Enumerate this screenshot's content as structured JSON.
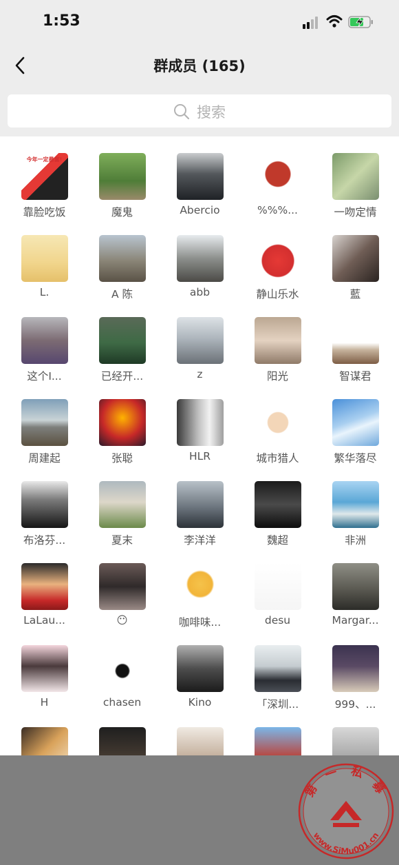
{
  "status_bar": {
    "time": "1:53",
    "icons": [
      "signal-icon",
      "wifi-icon",
      "battery-charging-icon"
    ]
  },
  "nav": {
    "back_icon": "chevron-left-icon",
    "title": "群成员 (165)"
  },
  "search": {
    "icon": "search-icon",
    "placeholder": "搜索"
  },
  "members": [
    {
      "name": "靠脸吃饭",
      "bg": "linear-gradient(135deg,#fff 0%,#fff 40%,#e53935 40%,#e53935 55%,#222 55%,#222 100%)",
      "badge": "今年一定暴富!"
    },
    {
      "name": "魔鬼",
      "bg": "linear-gradient(180deg,#7fae5a 0%,#4f7d38 60%,#9a8a6a 100%)"
    },
    {
      "name": "Abercio",
      "bg": "linear-gradient(180deg,#c9ccce 0%,#53575b 45%,#1f2226 100%)"
    },
    {
      "name": "%%%...",
      "bg": "radial-gradient(circle at 50% 45%,#c0392b 0%,#c0392b 35%,#ffffff 38%,#ffffff 100%)"
    },
    {
      "name": "一吻定情",
      "bg": "linear-gradient(135deg,#7c9b6a 0%,#c6d6a8 50%,#7a8f70 100%)"
    },
    {
      "name": "L.",
      "bg": "linear-gradient(180deg,#f6e7b4 0%,#f1d58c 60%,#e5c06a 100%)"
    },
    {
      "name": "A 陈",
      "bg": "linear-gradient(180deg,#b8c4cf 0%,#8a8577 55%,#5a5246 100%)"
    },
    {
      "name": "abb",
      "bg": "linear-gradient(180deg,#e7ebee 0%,#8c8f8c 50%,#4b4a46 100%)"
    },
    {
      "name": "静山乐水",
      "bg": "radial-gradient(circle at 50% 55%,#e53935 0%,#d32f2f 45%,#ffffff 48%,#ffffff 100%)"
    },
    {
      "name": "藍",
      "bg": "linear-gradient(135deg,#d8d3cf 0%,#6f5d55 50%,#2b2421 100%)"
    },
    {
      "name": "这个I...",
      "bg": "linear-gradient(180deg,#b7b7bb 0%,#7c6b73 50%,#57476f 100%)"
    },
    {
      "name": "已经开...",
      "bg": "linear-gradient(180deg,#5a6a58 0%,#3e6a45 55%,#1f3a26 100%)"
    },
    {
      "name": "z",
      "bg": "linear-gradient(180deg,#dde2e6 0%,#aeb6bd 45%,#6b7177 100%)"
    },
    {
      "name": "阳光",
      "bg": "linear-gradient(180deg,#bba792 0%,#e4d2c1 50%,#8f7a68 100%)"
    },
    {
      "name": "智谋君",
      "bg": "linear-gradient(180deg,#ffffff 0%,#ffffff 55%,#c6b39d 70%,#7d5d45 100%)"
    },
    {
      "name": "周建起",
      "bg": "linear-gradient(180deg,#7f9fb8 0%,#c9d3d6 45%,#7d7f7c 60%,#5b5140 100%)"
    },
    {
      "name": "张聪",
      "bg": "radial-gradient(circle at 50% 40%,#ffb300 0%,#c62828 55%,#2b1b2b 100%)"
    },
    {
      "name": "HLR",
      "bg": "linear-gradient(90deg,#3a3a3a 0%,#bdbdbd 45%,#f2f2f2 70%,#9e9e9e 100%)"
    },
    {
      "name": "城市猎人",
      "bg": "radial-gradient(circle at 50% 50%,#f3d6b8 0%,#f3d6b8 30%,#ffffff 33%,#ffffff 100%)"
    },
    {
      "name": "繁华落尽",
      "bg": "linear-gradient(160deg,#4a90d9 0%,#a9cff0 45%,#e9f4fc 60%,#6fa8dc 100%)"
    },
    {
      "name": "布洛芬...",
      "bg": "linear-gradient(180deg,#e9e9e9 0%,#7a7a7a 40%,#151515 100%)"
    },
    {
      "name": "夏末",
      "bg": "linear-gradient(180deg,#aeb9bf 0%,#ddd7c9 45%,#6b8a4a 100%)"
    },
    {
      "name": "李洋洋",
      "bg": "linear-gradient(180deg,#b8c1c8 0%,#6d767f 55%,#2c3238 100%)"
    },
    {
      "name": "魏超",
      "bg": "linear-gradient(180deg,#1b1b1b 0%,#4a4a4a 50%,#0d0d0d 100%)"
    },
    {
      "name": "非洲",
      "bg": "linear-gradient(180deg,#a9d4f2 0%,#5aa7d6 45%,#dfe8ea 70%,#2f6f8f 100%)"
    },
    {
      "name": "LaLau...",
      "bg": "linear-gradient(180deg,#2a2a2a 0%,#e9b27f 45%,#c62828 80%,#8b1a1a 100%)"
    },
    {
      "name": "😶",
      "bg": "linear-gradient(180deg,#6b5a57 0%,#2f2a2a 50%,#9a8a86 100%)"
    },
    {
      "name": "咖啡味...",
      "bg": "radial-gradient(circle at 50% 45%,#f5c24a 0%,#f2b53a 35%,#ffffff 40%,#ffffff 100%)"
    },
    {
      "name": "desu",
      "bg": "linear-gradient(180deg,#ffffff 0%,#f5f5f5 100%)"
    },
    {
      "name": "Margar...",
      "bg": "linear-gradient(180deg,#8f8f86 0%,#5b5a52 55%,#2c2c28 100%)"
    },
    {
      "name": "H",
      "bg": "linear-gradient(180deg,#f4d6dd 0%,#4a3a3c 45%,#f2e6e8 100%)"
    },
    {
      "name": "chasen",
      "bg": "radial-gradient(circle at 50% 55%,#111 0%,#111 18%,#ffffff 22%,#ffffff 100%)"
    },
    {
      "name": "Kino",
      "bg": "linear-gradient(180deg,#b0b0b0 0%,#4d4d4d 50%,#1b1b1b 100%)"
    },
    {
      "name": "「深圳...",
      "bg": "linear-gradient(180deg,#e9eef0 0%,#c5ccd0 45%,#2a2d33 75%,#4b4f56 100%)"
    },
    {
      "name": "999、...",
      "bg": "linear-gradient(180deg,#3b3350 0%,#5a4a64 45%,#d8cbb9 100%)"
    }
  ],
  "partial_row": [
    {
      "bg": "linear-gradient(135deg,#3a2d24 0%,#d9a25a 50%,#f4e3c8 100%)"
    },
    {
      "bg": "linear-gradient(180deg,#1f1f1f 0%,#5a4a3c 100%)"
    },
    {
      "bg": "linear-gradient(180deg,#f0eae2 0%,#a98d74 100%)"
    },
    {
      "bg": "linear-gradient(180deg,#7bb6e8 0%,#c0392b 70%,#e6e6e6 100%)"
    },
    {
      "bg": "linear-gradient(180deg,#d8d8d8 0%,#8c8c8c 100%)"
    }
  ],
  "watermark": {
    "text": "www.SiMu001.cn",
    "chars": "第 一 私 募",
    "color": "#c62828"
  }
}
